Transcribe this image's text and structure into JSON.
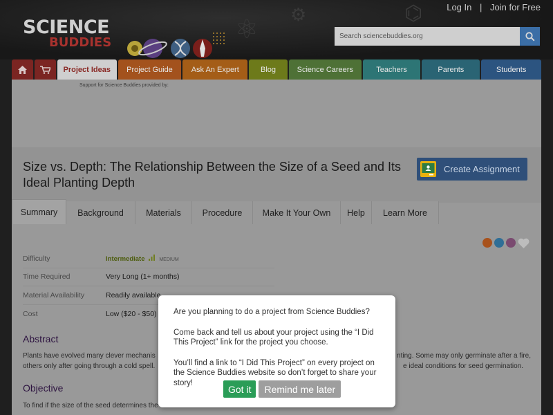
{
  "header": {
    "logo_top": "SCIENCE",
    "logo_bottom": "BUDDIES",
    "login_label": "Log In",
    "separator": "|",
    "join_label": "Join for Free",
    "search_placeholder": "Search sciencebuddies.org"
  },
  "nav": {
    "items": [
      {
        "label": "Project Ideas",
        "color": "#cfcfcf",
        "active": true
      },
      {
        "label": "Project Guide",
        "color": "#a3521d"
      },
      {
        "label": "Ask An Expert",
        "color": "#a45d17"
      },
      {
        "label": "Blog",
        "color": "#6d7a1a"
      },
      {
        "label": "Science Careers",
        "color": "#4e7136"
      },
      {
        "label": "Teachers",
        "color": "#2d7575"
      },
      {
        "label": "Parents",
        "color": "#2a6474"
      },
      {
        "label": "Students",
        "color": "#2c5480"
      }
    ]
  },
  "ad": {
    "support_label": "Support for Science Buddies provided by:"
  },
  "project": {
    "title": "Size vs. Depth: The Relationship Between the Size of a Seed and Its Ideal Planting Depth",
    "create_assignment": "Create Assignment"
  },
  "tabs": [
    "Summary",
    "Background",
    "Materials",
    "Procedure",
    "Make It Your Own",
    "Help",
    "Learn More"
  ],
  "info": {
    "difficulty_key": "Difficulty",
    "difficulty_level": "Intermediate",
    "difficulty_medium": "MEDIUM",
    "time_key": "Time Required",
    "time_val": "Very Long (1+ months)",
    "material_key": "Material Availability",
    "material_val": "Readily available",
    "cost_key": "Cost",
    "cost_val": "Low ($20 - $50)"
  },
  "abstract": {
    "heading": "Abstract",
    "line1_start": "Plants have evolved many clever mechanis",
    "line1_end": "nting. Some may only germinate after a fire,",
    "line2_start": "others only after going through a cold spell.",
    "line2_end": "e ideal conditions for seed germination."
  },
  "objective": {
    "heading": "Objective",
    "text": "To find if the size of the seed determines the"
  },
  "modal": {
    "line1": "Are you planning to do a project from Science Buddies?",
    "line2": "Come back and tell us about your project using the “I Did This Project” link for the project you choose.",
    "line3": "You’ll find a link to “I Did This Project” on every project on the Science Buddies website so don’t forget to share your story!",
    "ok_label": "Got it",
    "later_label": "Remind me later"
  },
  "colors": {
    "share_icons": [
      "#a8521c",
      "#2f6e96",
      "#7a4a70",
      "#bdbdbd"
    ]
  }
}
